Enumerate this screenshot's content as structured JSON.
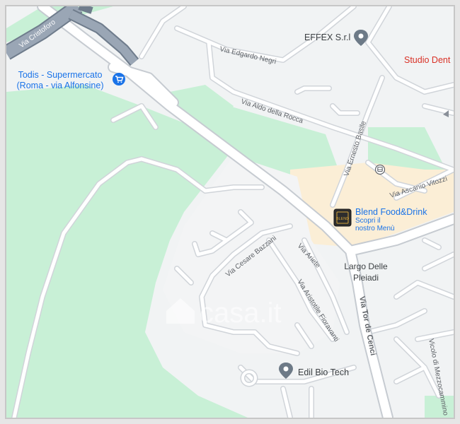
{
  "colors": {
    "frame_border": "#c7c7c7",
    "land": "#f1f3f4",
    "park": "#c8f0d6",
    "park_light": "#d5f3df",
    "commercial": "#fbeed6",
    "road": "#ffffff",
    "road_casing": "#d0d4d9",
    "highway": "#9aa6b5",
    "highway_casing": "#6f7c8c",
    "poi_blue": "#1a73e8",
    "poi_gray": "#5f6368",
    "poi_red": "#d93025"
  },
  "streets": {
    "via_cristoforo": "Via Cristoforo",
    "via_edgardo_negri": "Via Edgardo Negri",
    "via_aldo_della_rocca": "Via Aldo della Rocca",
    "via_ernesto_basile": "Via Ernesto Basile",
    "via_ascanio_vitozzi": "Via Ascanio Vitozzi",
    "via_cesare_bazzani": "Via Cesare Bazzani",
    "via_ariete": "Via Ariete",
    "via_aristotile_fioravanti": "Via Aristotile Fioravanti",
    "via_tor_de_cenci": "Via Tor de Cenci",
    "vicolo_di_mezzocammino": "Vicolo di Mezzocammino"
  },
  "places": {
    "todis_line1": "Todis - Supermercato",
    "todis_line2": "(Roma - via Alfonsine)",
    "effex": "EFFEX S.r.l",
    "studio_dent": "Studio Dent",
    "blend_title": "Blend Food&Drink",
    "blend_sub1": "Scopri il",
    "blend_sub2": "nostro Menù",
    "blend_logo_text": "BLEND",
    "largo_line1": "Largo Delle",
    "largo_line2": "Pleiadi",
    "edil_bio_tech": "Edil Bio Tech"
  },
  "icons": {
    "shopping_cart": "shopping-cart-icon",
    "place_pin": "place-pin-icon",
    "bus_stop": "bus-stop-icon",
    "compass_arrow": "arrow-icon",
    "blend_logo": "blend-logo-icon"
  },
  "watermark": "casa.it"
}
